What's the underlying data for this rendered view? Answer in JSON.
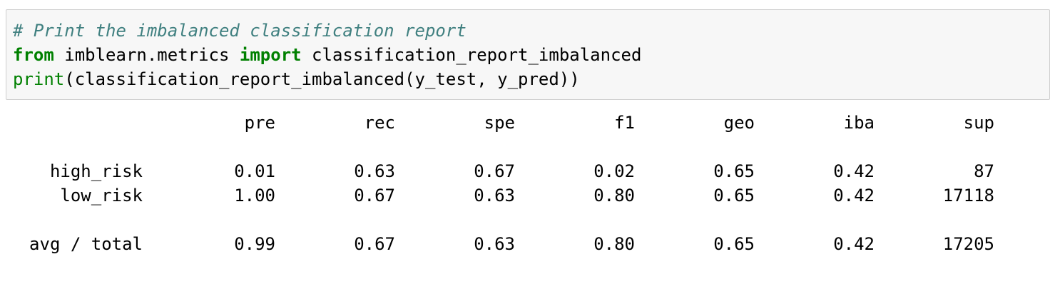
{
  "code": {
    "line1": "# Print the imbalanced classification report",
    "line2_kw_from": "from",
    "line2_module": " imblearn.metrics ",
    "line2_kw_import": "import",
    "line2_name": " classification_report_imbalanced",
    "line3_builtin": "print",
    "line3_rest": "(classification_report_imbalanced(y_test, y_pred))"
  },
  "report": {
    "headers": [
      "pre",
      "rec",
      "spe",
      "f1",
      "geo",
      "iba",
      "sup"
    ],
    "rows": [
      {
        "label": "high_risk",
        "values": [
          "0.01",
          "0.63",
          "0.67",
          "0.02",
          "0.65",
          "0.42",
          "87"
        ]
      },
      {
        "label": "low_risk",
        "values": [
          "1.00",
          "0.67",
          "0.63",
          "0.80",
          "0.65",
          "0.42",
          "17118"
        ]
      }
    ],
    "total": {
      "label": "avg / total",
      "values": [
        "0.99",
        "0.67",
        "0.63",
        "0.80",
        "0.65",
        "0.42",
        "17205"
      ]
    }
  },
  "colors": {
    "comment": "#408080",
    "keyword": "#008000",
    "cell_background": "#f7f7f7",
    "cell_border": "#cfcfcf"
  }
}
